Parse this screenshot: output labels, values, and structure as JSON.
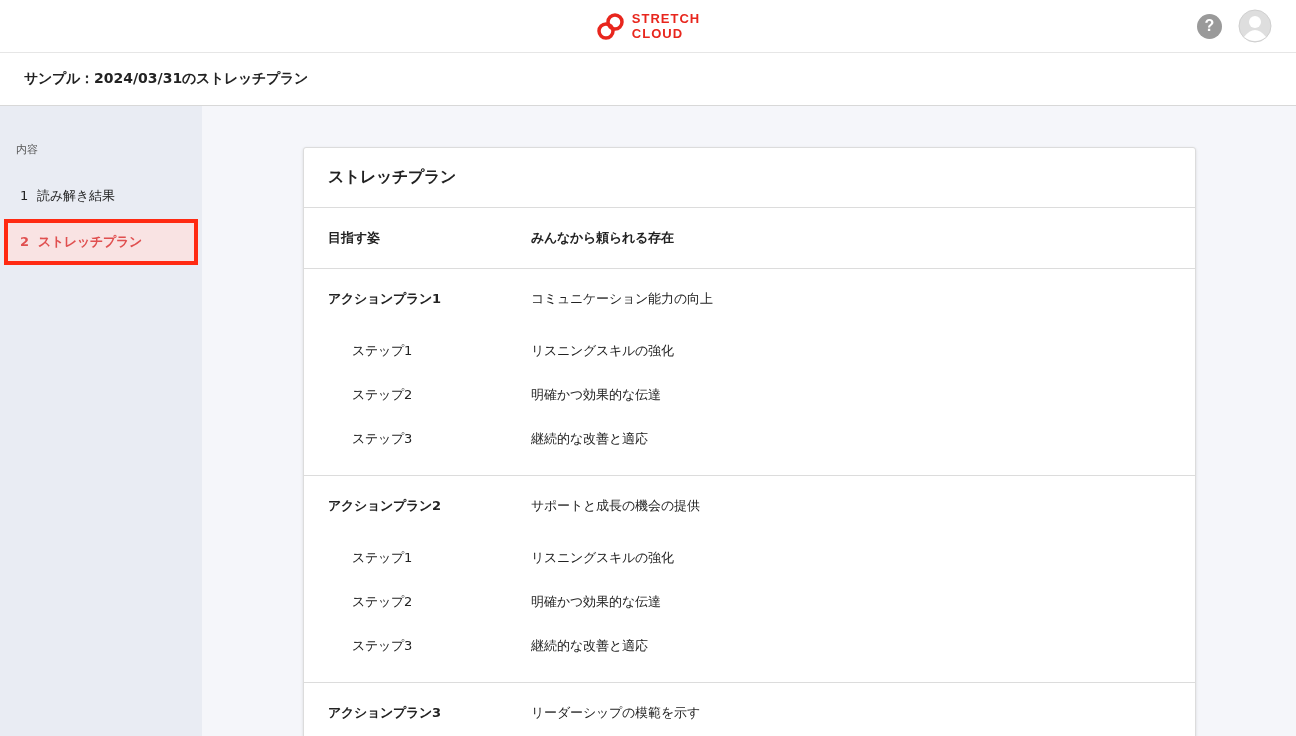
{
  "header": {
    "logo_lines": [
      "STRETCH",
      "CLOUD"
    ],
    "help": "?"
  },
  "page_title": "サンプル：2024/03/31のストレッチプラン",
  "sidebar": {
    "heading": "内容",
    "items": [
      {
        "number": "1",
        "label": "読み解き結果",
        "selected": false
      },
      {
        "number": "2",
        "label": "ストレッチプラン",
        "selected": true
      }
    ]
  },
  "card": {
    "title": "ストレッチプラン",
    "goal": {
      "label": "目指す姿",
      "value": "みんなから頼られる存在"
    },
    "action_plans": [
      {
        "label": "アクションプラン1",
        "value": "コミュニケーション能力の向上",
        "steps": [
          {
            "label": "ステップ1",
            "value": "リスニングスキルの強化"
          },
          {
            "label": "ステップ2",
            "value": "明確かつ効果的な伝達"
          },
          {
            "label": "ステップ3",
            "value": "継続的な改善と適応"
          }
        ]
      },
      {
        "label": "アクションプラン2",
        "value": "サポートと成長の機会の提供",
        "steps": [
          {
            "label": "ステップ1",
            "value": "リスニングスキルの強化"
          },
          {
            "label": "ステップ2",
            "value": "明確かつ効果的な伝達"
          },
          {
            "label": "ステップ3",
            "value": "継続的な改善と適応"
          }
        ]
      },
      {
        "label": "アクションプラン3",
        "value": "リーダーシップの模範を示す"
      }
    ]
  }
}
